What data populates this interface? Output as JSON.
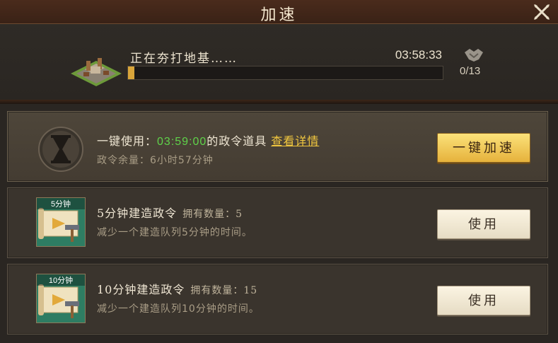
{
  "header": {
    "title": "加速",
    "close_icon": "close-x-icon"
  },
  "progress": {
    "label": "正在夯打地基……",
    "time": "03:58:33",
    "fraction": 0.005,
    "fill_color": "#d9a53a",
    "help_count": "0/13",
    "help_icon": "handshake-icon",
    "building_icon": "construction-site-icon"
  },
  "speedup_all": {
    "label_prefix": "一键使用：",
    "time": "03:59:00",
    "label_suffix": "的政令道具",
    "details_link": "查看详情",
    "remaining": "政令余量：6小时57分钟",
    "button": "一键加速",
    "icon": "hourglass-icon"
  },
  "items": [
    {
      "tag": "5分钟",
      "name": "5分钟建造政令",
      "count_label": "拥有数量：5",
      "desc": "减少一个建造队列5分钟的时间。",
      "button": "使用",
      "icon": "scroll-hammer-icon"
    },
    {
      "tag": "10分钟",
      "name": "10分钟建造政令",
      "count_label": "拥有数量：15",
      "desc": "减少一个建造队列10分钟的时间。",
      "button": "使用",
      "icon": "scroll-hammer-icon"
    }
  ],
  "colors": {
    "accent_green": "#5fd24a",
    "link_gold": "#f2c83f",
    "button_gold": "#e6b23c"
  }
}
